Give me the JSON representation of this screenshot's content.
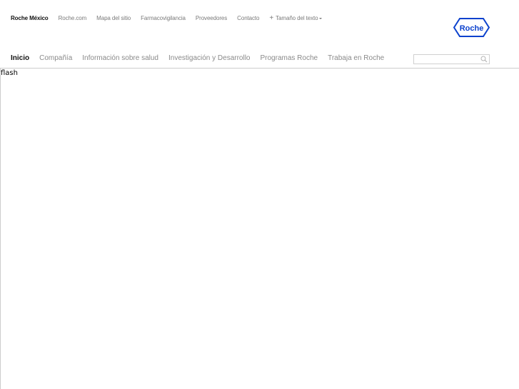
{
  "colors": {
    "brand_blue": "#0b41cd",
    "text_dark": "#111111",
    "text_muted": "#7a7a7a",
    "divider": "#cccccc"
  },
  "utility_nav": {
    "items": [
      {
        "label": "Roche México",
        "active": true
      },
      {
        "label": "Roche.com"
      },
      {
        "label": "Mapa del sitio"
      },
      {
        "label": "Farmacovigilancia"
      },
      {
        "label": "Proveedores"
      },
      {
        "label": "Contacto"
      }
    ],
    "text_size": {
      "icon": "plus-icon",
      "label": "Tamaño del texto",
      "caret": "chevron-down-icon"
    }
  },
  "logo": {
    "text": "Roche",
    "icon": "roche-hexagon-logo"
  },
  "main_nav": {
    "items": [
      {
        "label": "Inicio",
        "active": true
      },
      {
        "label": "Compañía"
      },
      {
        "label": "Información sobre salud"
      },
      {
        "label": "Investigación y Desarrollo"
      },
      {
        "label": "Programas Roche"
      },
      {
        "label": "Trabaja en Roche"
      }
    ]
  },
  "search": {
    "placeholder": "",
    "value": "",
    "icon": "search-icon"
  },
  "content": {
    "placeholder_text": "flash"
  }
}
